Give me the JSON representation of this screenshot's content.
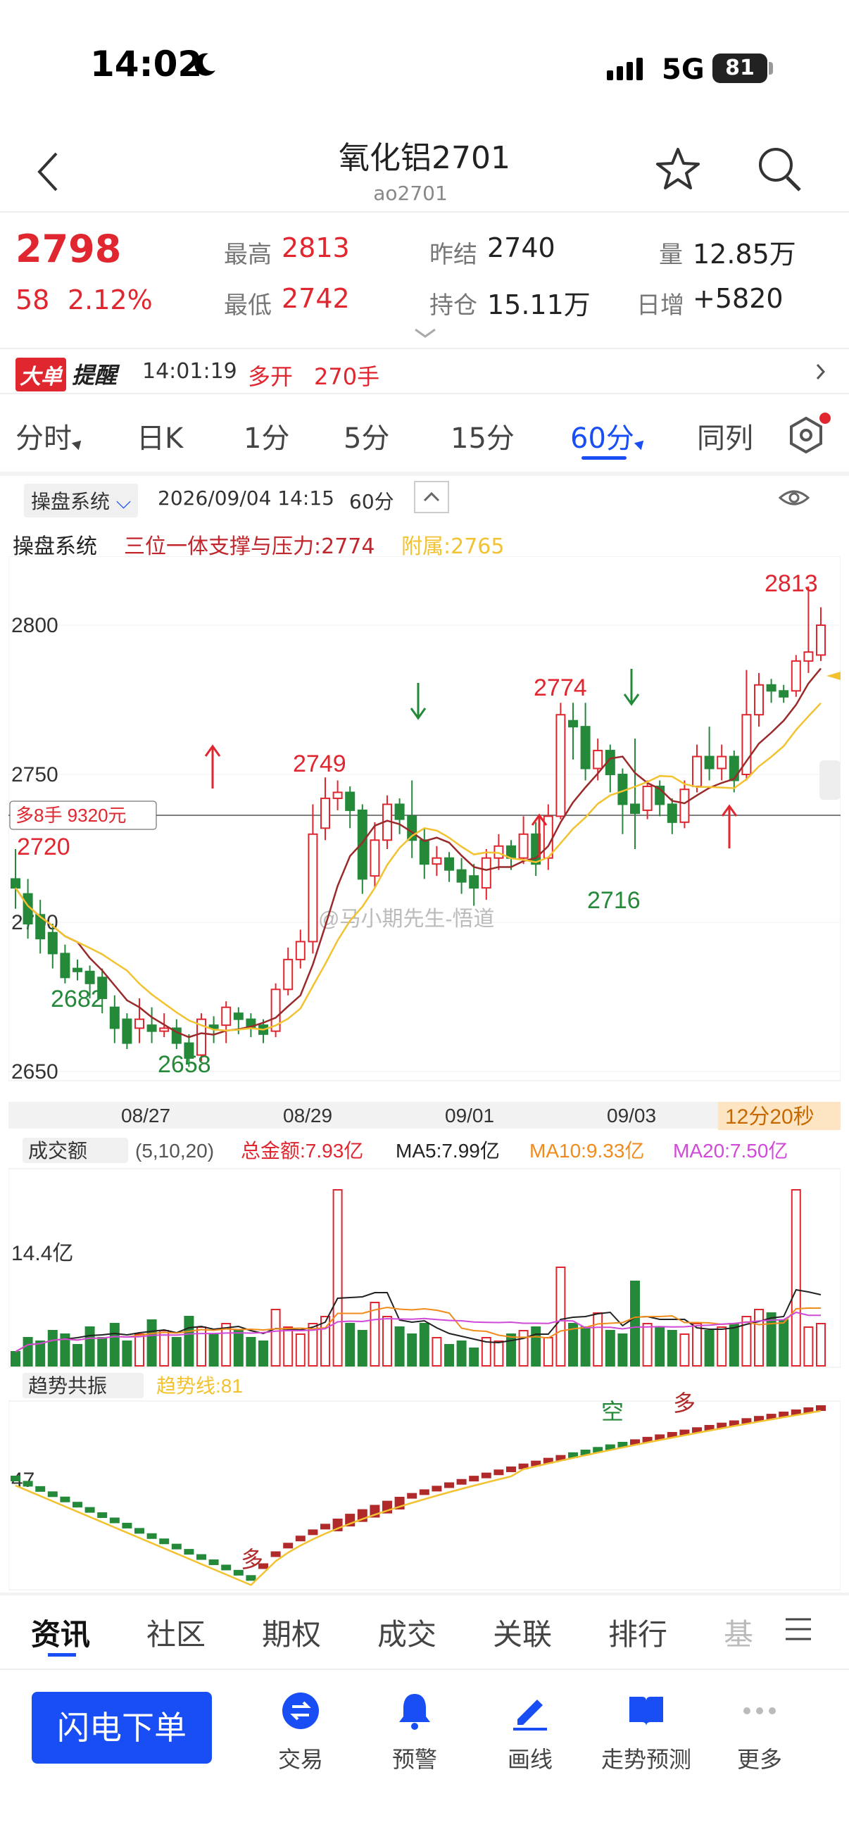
{
  "status": {
    "time": "14:02",
    "network": "5G",
    "battery": "81"
  },
  "header": {
    "title": "氧化铝2701",
    "code": "ao2701"
  },
  "quote": {
    "price": "2798",
    "change": "58",
    "change_pct": "2.12%",
    "high_label": "最高",
    "high": "2813",
    "low_label": "最低",
    "low": "2742",
    "prev_settle_label": "昨结",
    "prev_settle": "2740",
    "open_interest_label": "持仓",
    "open_interest": "15.11万",
    "volume_label": "量",
    "volume": "12.85万",
    "daily_inc_label": "日增",
    "daily_inc": "+5820"
  },
  "alert": {
    "badge1": "大单",
    "badge2": "提醒",
    "time": "14:01:19",
    "action": "多开",
    "qty": "270手"
  },
  "tabs": [
    {
      "label": "分时"
    },
    {
      "label": "日K"
    },
    {
      "label": "1分"
    },
    {
      "label": "5分"
    },
    {
      "label": "15分"
    },
    {
      "label": "60分"
    },
    {
      "label": "同列"
    }
  ],
  "indicator_bar": {
    "system": "操盘系统",
    "datetime": "2026/09/04 14:15",
    "period": "60分"
  },
  "main_legend": {
    "name": "操盘系统",
    "line1": "三位一体支撑与压力:2774",
    "line2": "附属:2765"
  },
  "price_chart": {
    "y_labels": [
      "2800",
      "2750",
      "2700",
      "2650"
    ],
    "x_labels": [
      "08/27",
      "08/29",
      "09/01",
      "09/03"
    ],
    "countdown": "12分20秒",
    "position_tag": "多8手 9320元",
    "annotations": [
      "2813",
      "2774",
      "2749",
      "2720",
      "2716",
      "2682",
      "2658"
    ],
    "watermark": "@马小期先生-悟道"
  },
  "volume_legend": {
    "name": "成交额",
    "params": "(5,10,20)",
    "total": "总金额:7.93亿",
    "ma5": "MA5:7.99亿",
    "ma10": "MA10:9.33亿",
    "ma20": "MA20:7.50亿",
    "y_label": "14.4亿"
  },
  "trend_legend": {
    "name": "趋势共振",
    "value": "趋势线:81",
    "y_label": "47",
    "tags": [
      "多",
      "空",
      "多"
    ]
  },
  "bottom_tabs": [
    {
      "label": "资讯"
    },
    {
      "label": "社区"
    },
    {
      "label": "期权"
    },
    {
      "label": "成交"
    },
    {
      "label": "关联"
    },
    {
      "label": "排行"
    },
    {
      "label": "基"
    }
  ],
  "toolbar": {
    "buy": "闪电下单",
    "items": [
      {
        "label": "交易"
      },
      {
        "label": "预警"
      },
      {
        "label": "画线"
      },
      {
        "label": "走势预测"
      },
      {
        "label": "更多"
      }
    ]
  },
  "colors": {
    "up": "#e0262f",
    "down": "#25893a",
    "accent": "#1a4ef5",
    "ma_yellow": "#f2c230",
    "ma_dark": "#9a2a2a",
    "ma20": "#d04ad8",
    "ma10": "#f08c1c"
  }
}
